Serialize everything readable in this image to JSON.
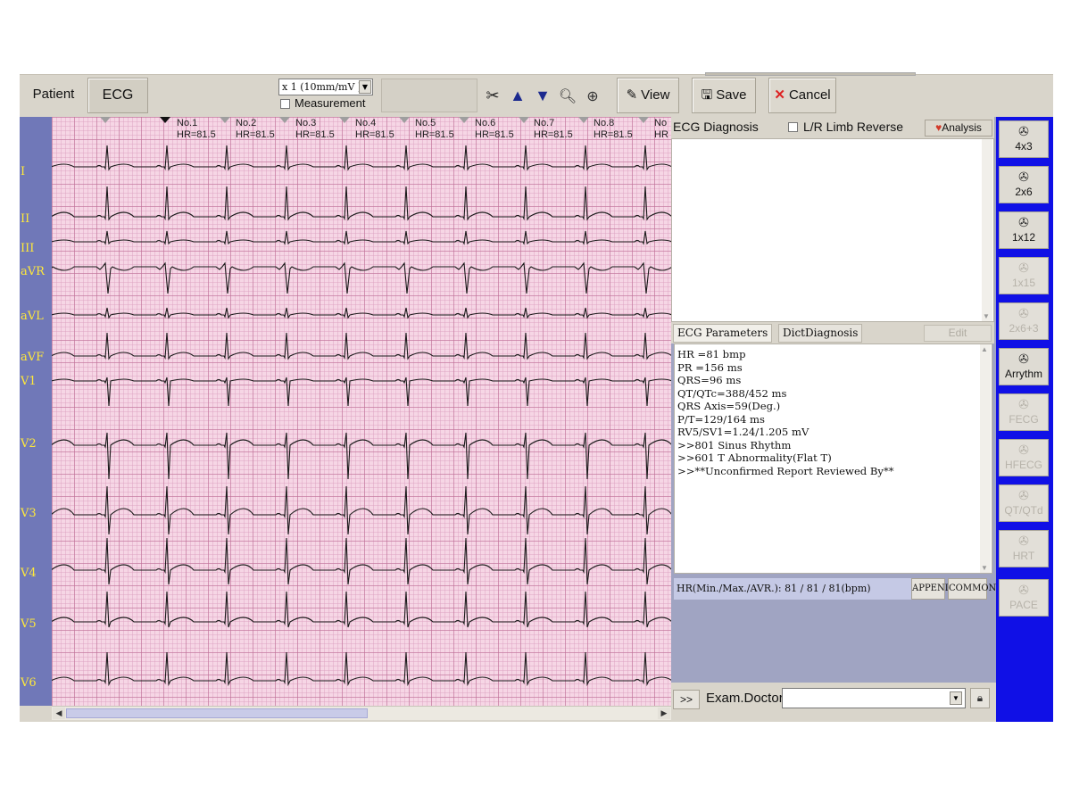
{
  "toolbar": {
    "tabs": [
      {
        "label": "Patient"
      },
      {
        "label": "ECG"
      }
    ],
    "gain_select": "x 1 (10mm/mV )",
    "measurement_label": "Measurement",
    "view_label": "View",
    "save_label": "Save",
    "cancel_label": "Cancel"
  },
  "ecg": {
    "lead_labels": [
      "I",
      "II",
      "III",
      "aVR",
      "aVL",
      "aVF",
      "V1",
      "V2",
      "V3",
      "V4",
      "V5",
      "V6"
    ],
    "beats": [
      {
        "no": "No.1",
        "hr": "HR=81.5"
      },
      {
        "no": "No.2",
        "hr": "HR=81.5"
      },
      {
        "no": "No.3",
        "hr": "HR=81.5"
      },
      {
        "no": "No.4",
        "hr": "HR=81.5"
      },
      {
        "no": "No.5",
        "hr": "HR=81.5"
      },
      {
        "no": "No.6",
        "hr": "HR=81.5"
      },
      {
        "no": "No.7",
        "hr": "HR=81.5"
      },
      {
        "no": "No.8",
        "hr": "HR=81.5"
      },
      {
        "no": "No",
        "hr": "HR"
      }
    ],
    "trace_color": "#1a1a1a",
    "grid_color": "#f6d6e5"
  },
  "diagnosis": {
    "title": "ECG Diagnosis",
    "limb_reverse_label": "L/R Limb Reverse",
    "analysis_label": "Analysis",
    "tabs": [
      {
        "label": "ECG Parameters"
      },
      {
        "label": "DictDiagnosis"
      }
    ],
    "edit_label": "Edit",
    "parameters": [
      "HR =81 bmp",
      "PR =156 ms",
      "QRS=96 ms",
      "QT/QTc=388/452 ms",
      "QRS Axis=59(Deg.)",
      "P/T=129/164 ms",
      "RV5/SV1=1.24/1.205 mV",
      ">>801 Sinus Rhythm",
      ">>601 T Abnormality(Flat T)",
      ">>**Unconfirmed Report Reviewed By**"
    ],
    "hr_stats": "HR(Min./Max./AVR.): 81 / 81 / 81(bpm)",
    "append_label": "APPEND",
    "common_label": "COMMON",
    "expand_label": ">>",
    "exam_doctor_label": "Exam.Doctor"
  },
  "layouts": [
    {
      "label": "4x3",
      "enabled": true
    },
    {
      "label": "2x6",
      "enabled": true
    },
    {
      "label": "1x12",
      "enabled": true
    },
    {
      "label": "1x15",
      "enabled": false
    },
    {
      "label": "2x6+3",
      "enabled": false
    },
    {
      "label": "Arrythm",
      "enabled": true
    },
    {
      "label": "FECG",
      "enabled": false
    },
    {
      "label": "HFECG",
      "enabled": false
    },
    {
      "label": "QT/QTd",
      "enabled": false
    },
    {
      "label": "HRT",
      "enabled": false
    },
    {
      "label": "PACE",
      "enabled": false
    }
  ]
}
